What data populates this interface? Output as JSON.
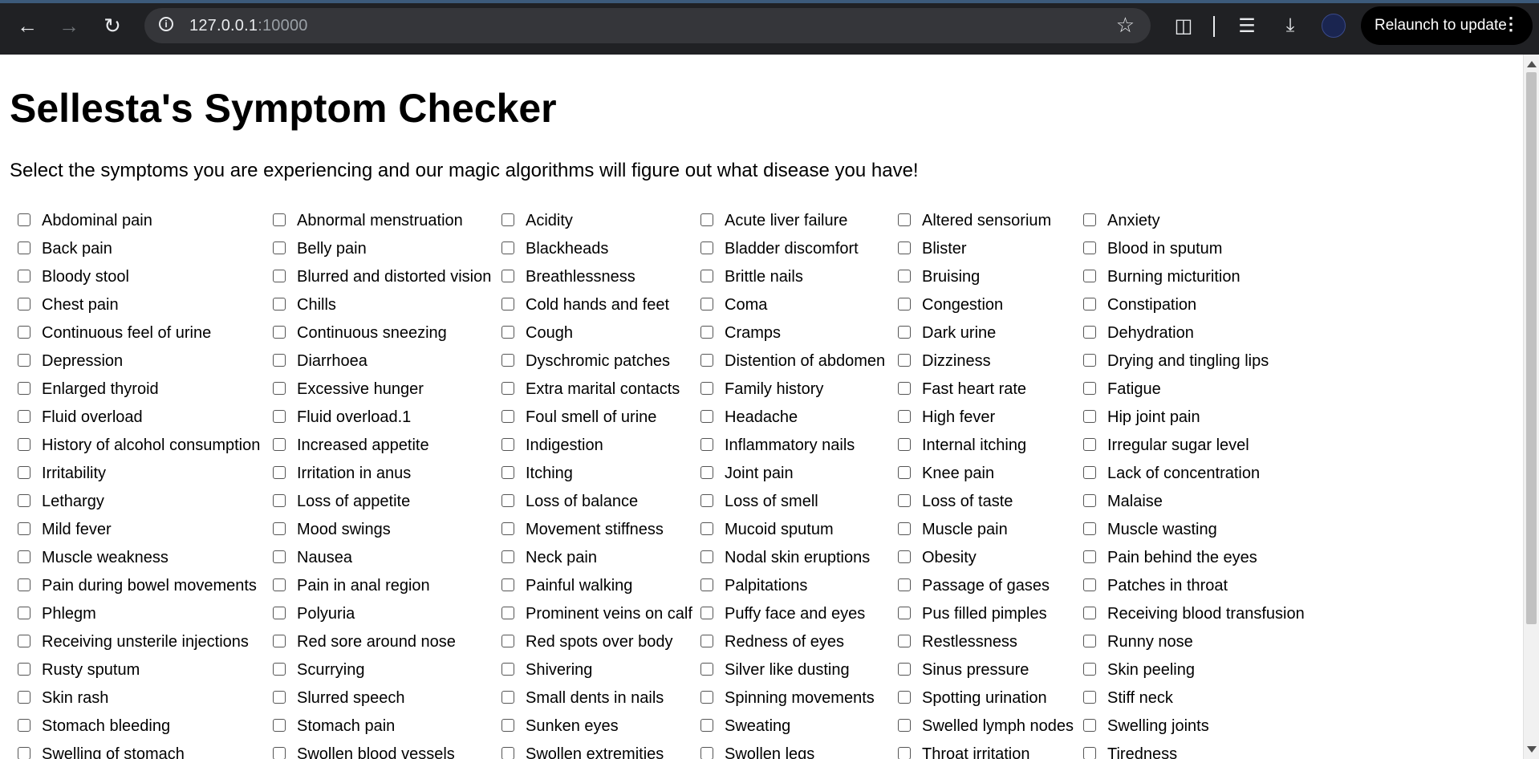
{
  "browser": {
    "url_host": "127.0.0.1",
    "url_port": ":10000",
    "relaunch_label": "Relaunch to update"
  },
  "page": {
    "title": "Sellesta's Symptom Checker",
    "subtitle": "Select the symptoms you are experiencing and our magic algorithms will figure out what disease you have!"
  },
  "symptoms": [
    "Abdominal pain",
    "Abnormal menstruation",
    "Acidity",
    "Acute liver failure",
    "Altered sensorium",
    "Anxiety",
    "Back pain",
    "Belly pain",
    "Blackheads",
    "Bladder discomfort",
    "Blister",
    "Blood in sputum",
    "Bloody stool",
    "Blurred and distorted vision",
    "Breathlessness",
    "Brittle nails",
    "Bruising",
    "Burning micturition",
    "Chest pain",
    "Chills",
    "Cold hands and feet",
    "Coma",
    "Congestion",
    "Constipation",
    "Continuous feel of urine",
    "Continuous sneezing",
    "Cough",
    "Cramps",
    "Dark urine",
    "Dehydration",
    "Depression",
    "Diarrhoea",
    "Dyschromic patches",
    "Distention of abdomen",
    "Dizziness",
    "Drying and tingling lips",
    "Enlarged thyroid",
    "Excessive hunger",
    "Extra marital contacts",
    "Family history",
    "Fast heart rate",
    "Fatigue",
    "Fluid overload",
    "Fluid overload.1",
    "Foul smell of urine",
    "Headache",
    "High fever",
    "Hip joint pain",
    "History of alcohol consumption",
    "Increased appetite",
    "Indigestion",
    "Inflammatory nails",
    "Internal itching",
    "Irregular sugar level",
    "Irritability",
    "Irritation in anus",
    "Itching",
    "Joint pain",
    "Knee pain",
    "Lack of concentration",
    "Lethargy",
    "Loss of appetite",
    "Loss of balance",
    "Loss of smell",
    "Loss of taste",
    "Malaise",
    "Mild fever",
    "Mood swings",
    "Movement stiffness",
    "Mucoid sputum",
    "Muscle pain",
    "Muscle wasting",
    "Muscle weakness",
    "Nausea",
    "Neck pain",
    "Nodal skin eruptions",
    "Obesity",
    "Pain behind the eyes",
    "Pain during bowel movements",
    "Pain in anal region",
    "Painful walking",
    "Palpitations",
    "Passage of gases",
    "Patches in throat",
    "Phlegm",
    "Polyuria",
    "Prominent veins on calf",
    "Puffy face and eyes",
    "Pus filled pimples",
    "Receiving blood transfusion",
    "Receiving unsterile injections",
    "Red sore around nose",
    "Red spots over body",
    "Redness of eyes",
    "Restlessness",
    "Runny nose",
    "Rusty sputum",
    "Scurrying",
    "Shivering",
    "Silver like dusting",
    "Sinus pressure",
    "Skin peeling",
    "Skin rash",
    "Slurred speech",
    "Small dents in nails",
    "Spinning movements",
    "Spotting urination",
    "Stiff neck",
    "Stomach bleeding",
    "Stomach pain",
    "Sunken eyes",
    "Sweating",
    "Swelled lymph nodes",
    "Swelling joints",
    "Swelling of stomach",
    "Swollen blood vessels",
    "Swollen extremities",
    "Swollen legs",
    "Throat irritation",
    "Tiredness"
  ]
}
